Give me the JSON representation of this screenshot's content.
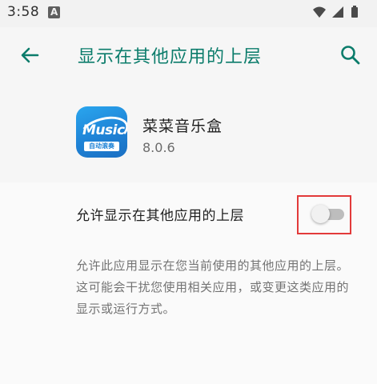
{
  "status_bar": {
    "time": "3:58",
    "notification_icon": "a-letter-icon",
    "wifi_icon": "wifi-icon",
    "signal_icon": "cell-signal-icon",
    "battery_icon": "battery-icon"
  },
  "app_bar": {
    "back_icon": "arrow-back-icon",
    "title": "显示在其他应用的上层",
    "search_icon": "search-icon"
  },
  "app_info": {
    "name": "菜菜音乐盒",
    "version": "8.0.6",
    "icon_word": "Music",
    "icon_sub": "自动滚奏"
  },
  "setting": {
    "label": "允许显示在其他应用的上层",
    "enabled": false,
    "description": "允许此应用显示在您当前使用的其他应用的上层。这可能会干扰您使用相关应用，或变更这类应用的显示或运行方式。"
  },
  "colors": {
    "accent": "#0b7c6b",
    "highlight": "#e23a3a",
    "toggle_off_track": "#bdbdbd",
    "toggle_off_thumb": "#f1f1f1"
  }
}
